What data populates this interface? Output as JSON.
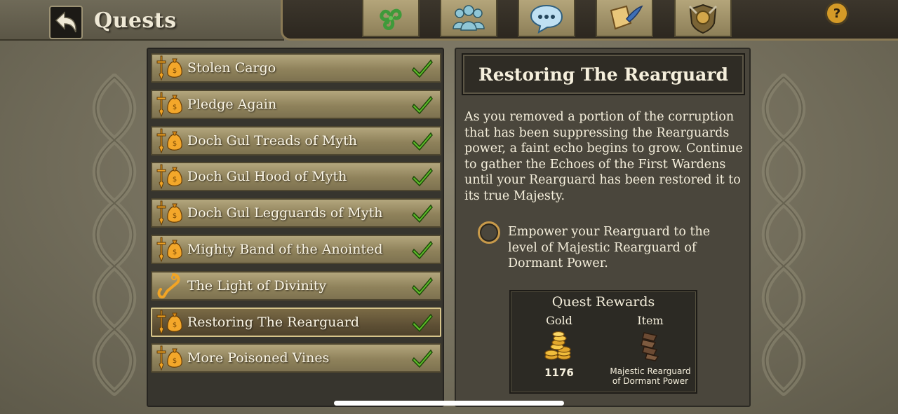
{
  "header": {
    "title": "Quests"
  },
  "tabs": [
    {
      "icon": "triskelion-icon"
    },
    {
      "icon": "fellowship-icon"
    },
    {
      "icon": "chat-icon"
    },
    {
      "icon": "scroll-quill-icon"
    },
    {
      "icon": "crest-shield-icon"
    }
  ],
  "help": {
    "label": "?"
  },
  "quests": [
    {
      "label": "Stolen Cargo",
      "icon": "sword-bag-icon",
      "completed": true
    },
    {
      "label": "Pledge Again",
      "icon": "sword-bag-icon",
      "completed": true
    },
    {
      "label": "Doch Gul Treads of Myth",
      "icon": "sword-bag-icon",
      "completed": true
    },
    {
      "label": "Doch Gul Hood of Myth",
      "icon": "sword-bag-icon",
      "completed": true
    },
    {
      "label": "Doch Gul Legguards of Myth",
      "icon": "sword-bag-icon",
      "completed": true
    },
    {
      "label": "Mighty Band of the Anointed",
      "icon": "sword-bag-icon",
      "completed": true
    },
    {
      "label": "The Light of Divinity",
      "icon": "hook-icon",
      "completed": true
    },
    {
      "label": "Restoring The Rearguard",
      "icon": "sword-bag-icon",
      "completed": true,
      "selected": true
    },
    {
      "label": "More Poisoned Vines",
      "icon": "sword-bag-icon",
      "completed": true
    }
  ],
  "detail": {
    "title": "Restoring The Rearguard",
    "description": "As you removed a portion of the corruption that has been suppressing the Rearguards power, a faint echo begins to grow. Continue to gather the Echoes of the First Wardens until your Rearguard has been restored it to its true Majesty.",
    "objective": "Empower your Rearguard to the level of Majestic Rearguard of Dormant Power.",
    "rewards": {
      "title": "Quest Rewards",
      "gold_label": "Gold",
      "gold_value": "1176",
      "item_label": "Item",
      "item_name": "Majestic Rearguard of Dormant Power"
    }
  },
  "colors": {
    "accent_gold": "#d49a27",
    "check_green": "#5fbf2a",
    "row_gold": "#b3a67d"
  }
}
